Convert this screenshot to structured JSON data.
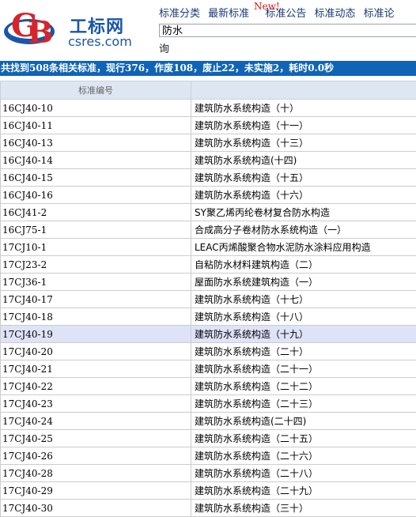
{
  "brand": {
    "name_cn": "工标网",
    "domain": "csres.com",
    "logo_letters": "GB",
    "colors": {
      "primary": "#1a55a7",
      "accent_red": "#d6242a"
    }
  },
  "nav": {
    "items": [
      "标准分类",
      "最新标准",
      "标准公告",
      "标准动态",
      "标准论"
    ],
    "new_badge": "New!"
  },
  "search": {
    "value": "防水",
    "button_label": "询"
  },
  "summary": "共找到508条相关标准，现行376，作废108，废止22，未实施2，耗时0.0秒",
  "table": {
    "headers": [
      "标准编号",
      ""
    ],
    "selected_index": 13,
    "rows": [
      {
        "code": "16CJ40-10",
        "name": "建筑防水系统构造（十）"
      },
      {
        "code": "16CJ40-11",
        "name": "建筑防水系统构造（十一）"
      },
      {
        "code": "16CJ40-13",
        "name": "建筑防水系统构造（十三）"
      },
      {
        "code": "16CJ40-14",
        "name": "建筑防水系统构造(十四)"
      },
      {
        "code": "16CJ40-15",
        "name": "建筑防水系统构造（十五）"
      },
      {
        "code": "16CJ40-16",
        "name": "建筑防水系统构造（十六）"
      },
      {
        "code": "16CJ41-2",
        "name": "SY聚乙烯丙纶卷材复合防水构造"
      },
      {
        "code": "16CJ75-1",
        "name": "合成高分子卷材防水系统构造（一）"
      },
      {
        "code": "17CJ10-1",
        "name": "LEAC丙烯酸聚合物水泥防水涂料应用构造"
      },
      {
        "code": "17CJ23-2",
        "name": "自粘防水材料建筑构造（二）"
      },
      {
        "code": "17CJ36-1",
        "name": "屋面防水系统建筑构造（一）"
      },
      {
        "code": "17CJ40-17",
        "name": "建筑防水系统构造（十七）"
      },
      {
        "code": "17CJ40-18",
        "name": "建筑防水系统构造（十八）"
      },
      {
        "code": "17CJ40-19",
        "name": "建筑防水系统构造（十九）"
      },
      {
        "code": "17CJ40-20",
        "name": "建筑防水系统构造（二十）"
      },
      {
        "code": "17CJ40-21",
        "name": "建筑防水系统构造（二十一）"
      },
      {
        "code": "17CJ40-22",
        "name": "建筑防水系统构造（二十二）"
      },
      {
        "code": "17CJ40-23",
        "name": "建筑防水系统构造（二十三）"
      },
      {
        "code": "17CJ40-24",
        "name": "建筑防水系统构造(二十四)"
      },
      {
        "code": "17CJ40-25",
        "name": "建筑防水系统构造（二十五）"
      },
      {
        "code": "17CJ40-26",
        "name": "建筑防水系统构造（二十六）"
      },
      {
        "code": "17CJ40-28",
        "name": "建筑防水系统构造（二十八）"
      },
      {
        "code": "17CJ40-29",
        "name": "建筑防水系统构造（二十九）"
      },
      {
        "code": "17CJ40-30",
        "name": "建筑防水系统构造（三十）"
      }
    ]
  }
}
